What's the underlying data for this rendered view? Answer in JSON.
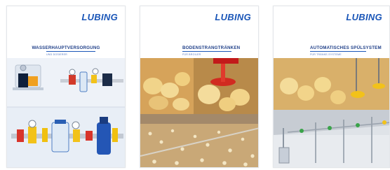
{
  "brochures": [
    {
      "logo": "LUBING",
      "title": "WASSERHAUPTVERSORGUNG",
      "subtitle": "UND DOSIERER"
    },
    {
      "logo": "LUBING",
      "title": "BODENSTRANGTRÄNKEN",
      "subtitle": "FÜR BROILER"
    },
    {
      "logo": "LUBING",
      "title": "AUTOMATISCHES SPÜLSYSTEM",
      "subtitle": "FÜR TRÄNKE-SYSTEME"
    }
  ],
  "colors": {
    "brand_blue": "#1a56b8",
    "title_blue": "#1f3f88"
  }
}
